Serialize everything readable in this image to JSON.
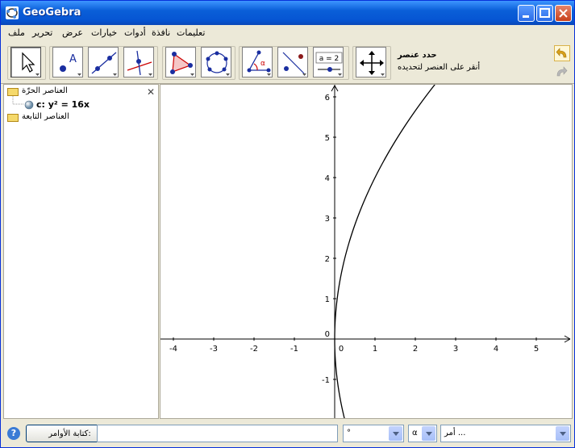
{
  "window": {
    "title": "GeoGebra"
  },
  "menu": {
    "items": [
      "ملف",
      "تحرير",
      "عرض",
      "خيارات",
      "أدوات",
      "نافذة",
      "تعليمات"
    ]
  },
  "toolbar": {
    "tools": [
      "move-tool",
      "point-tool",
      "line-tool",
      "perpendicular-tool",
      "polygon-tool",
      "circle-tool",
      "angle-tool",
      "reflect-tool",
      "slider-tool",
      "move-graphics-tool"
    ],
    "slider_label": "a = 2",
    "help_title": "حدد عنصر",
    "help_text": "أنقر على العنصر لتحديده",
    "angle_symbol": "α"
  },
  "algebra": {
    "free_objects": "العناصر الحرّة",
    "dependent_objects": "العناصر التابعة",
    "object_name": "c",
    "object_equation": "c: y² = 16x"
  },
  "graphics": {
    "x_ticks": [
      "-4",
      "-3",
      "-2",
      "-1",
      "0",
      "1",
      "2",
      "3",
      "4",
      "5"
    ],
    "y_ticks": [
      "6",
      "5",
      "4",
      "3",
      "2",
      "1",
      "0",
      "-1"
    ]
  },
  "input_bar": {
    "button_label": "كتابة الأوامر:",
    "symbol_value": "°",
    "greek_value": "α",
    "command_placeholder": "أمر ..."
  },
  "colors": {
    "curve": "#000000",
    "title_bar": "#0a5fd8"
  }
}
